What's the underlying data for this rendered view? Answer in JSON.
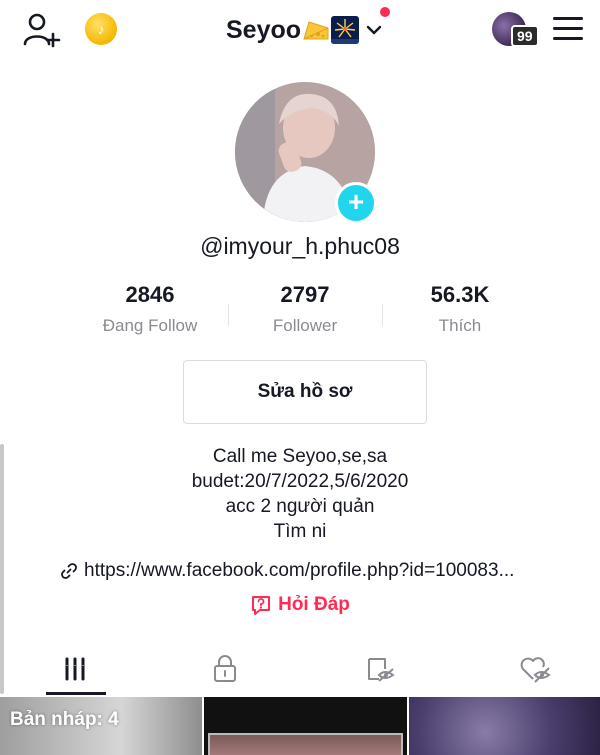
{
  "header": {
    "title": "Seyoo",
    "notification_badge": "99",
    "coin_glyph": "♪",
    "icons": [
      "add-user-icon",
      "coin-icon",
      "cheese-emoji-icon",
      "fireworks-emoji-icon",
      "chevron-down-icon",
      "menu-icon"
    ]
  },
  "profile": {
    "username": "@imyour_h.phuc08",
    "add_glyph": "+",
    "stats": [
      {
        "value": "2846",
        "label": "Đang Follow"
      },
      {
        "value": "2797",
        "label": "Follower"
      },
      {
        "value": "56.3K",
        "label": "Thích"
      }
    ],
    "edit_button": "Sửa hồ sơ",
    "bio_lines": [
      "Call me Seyoo,se,sa",
      "budet:20/7/2022,5/6/2020",
      "acc 2 người quản",
      "Tìm ni"
    ],
    "link": "https://www.facebook.com/profile.php?id=100083...",
    "qa_label": "Hỏi Đáp"
  },
  "tabs": {
    "items": [
      "videos-grid-icon",
      "private-lock-icon",
      "reposts-icon",
      "liked-hidden-icon"
    ],
    "active_index": 0
  },
  "grid": {
    "draft_label": "Bản nháp: 4"
  },
  "colors": {
    "accent_red": "#fe2c55",
    "plus_cyan": "#20d5ec",
    "text": "#161823",
    "muted": "#8a8b91"
  }
}
